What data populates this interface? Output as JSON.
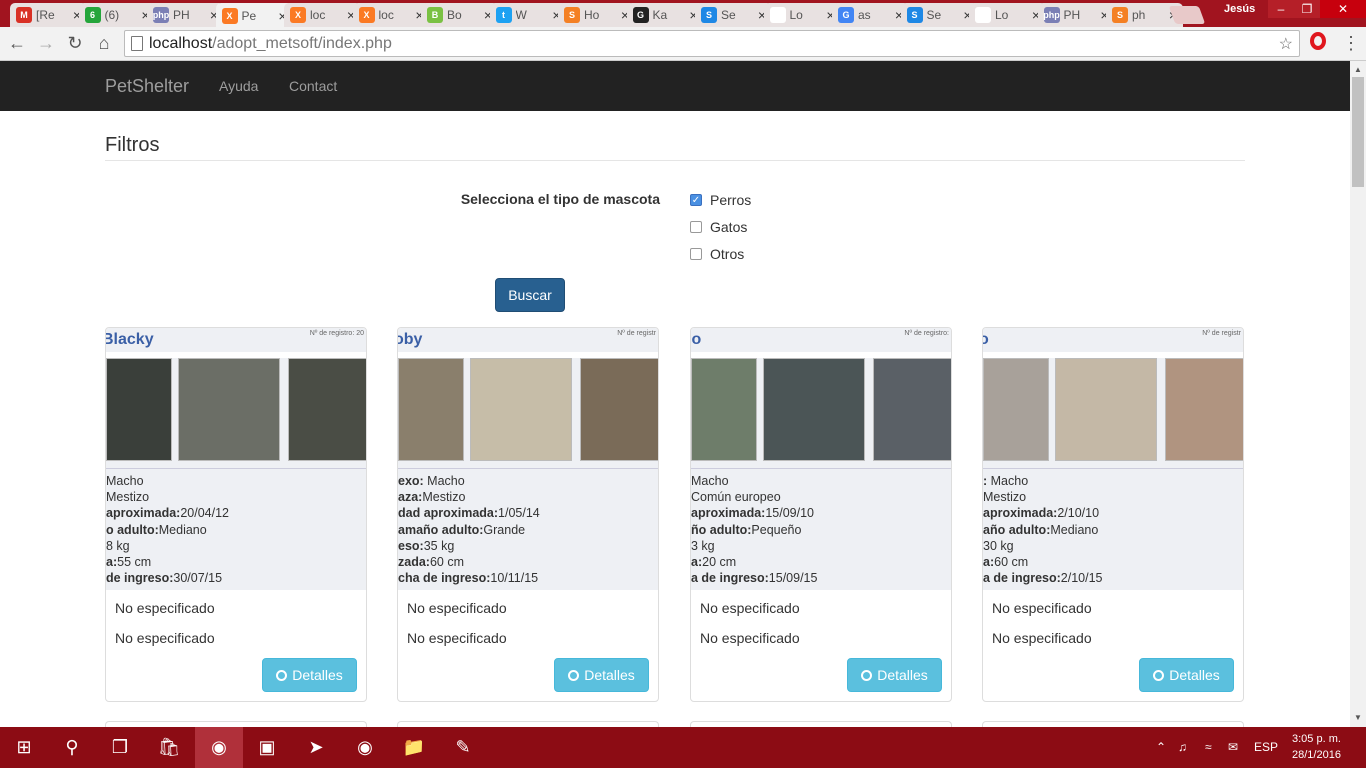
{
  "browser": {
    "tabs": [
      {
        "title": "[Re",
        "favicon_text": "M",
        "favicon_color": "#d93025",
        "active": false
      },
      {
        "title": "(6)",
        "favicon_text": "6",
        "favicon_color": "#25a53b",
        "active": false
      },
      {
        "title": "PH",
        "favicon_text": "php",
        "favicon_color": "#7b7fb5",
        "active": false
      },
      {
        "title": "Pe",
        "favicon_text": "X",
        "favicon_color": "#fb7a24",
        "active": true
      },
      {
        "title": "loc",
        "favicon_text": "X",
        "favicon_color": "#fb7a24",
        "active": false
      },
      {
        "title": "loc",
        "favicon_text": "X",
        "favicon_color": "#fb7a24",
        "active": false
      },
      {
        "title": "Bo",
        "favicon_text": "B",
        "favicon_color": "#7ac143",
        "active": false
      },
      {
        "title": "W",
        "favicon_text": "t",
        "favicon_color": "#1da1f2",
        "active": false
      },
      {
        "title": "Ho",
        "favicon_text": "S",
        "favicon_color": "#f48024",
        "active": false
      },
      {
        "title": "Ka",
        "favicon_text": "G",
        "favicon_color": "#222222",
        "active": false
      },
      {
        "title": "Se",
        "favicon_text": "S",
        "favicon_color": "#1e88e5",
        "active": false
      },
      {
        "title": "Lo",
        "favicon_text": "",
        "favicon_color": "#ffffff",
        "active": false
      },
      {
        "title": "as",
        "favicon_text": "G",
        "favicon_color": "#4285f4",
        "active": false
      },
      {
        "title": "Se",
        "favicon_text": "S",
        "favicon_color": "#1e88e5",
        "active": false
      },
      {
        "title": "Lo",
        "favicon_text": "",
        "favicon_color": "#ffffff",
        "active": false
      },
      {
        "title": "PH",
        "favicon_text": "php",
        "favicon_color": "#7b7fb5",
        "active": false
      },
      {
        "title": "ph",
        "favicon_text": "S",
        "favicon_color": "#f48024",
        "active": false
      }
    ],
    "user": "Jesús",
    "url_host": "localhost",
    "url_path": "/adopt_metsoft/index.php"
  },
  "site": {
    "brand": "PetShelter",
    "nav": [
      "Ayuda",
      "Contact"
    ]
  },
  "filters": {
    "title": "Filtros",
    "label": "Selecciona el tipo de mascota",
    "options": [
      {
        "label": "Perros",
        "checked": true
      },
      {
        "label": "Gatos",
        "checked": false
      },
      {
        "label": "Otros",
        "checked": false
      }
    ],
    "button": "Buscar"
  },
  "cards": [
    {
      "name": "Blacky",
      "reg": "Nº de registro: 20",
      "photo_colors": [
        "#3a3f3a",
        "#6b6e66",
        "#4a4d45"
      ],
      "facts": [
        {
          "k": "",
          "v": "Macho"
        },
        {
          "k": "",
          "v": "Mestizo"
        },
        {
          "k": "aproximada:",
          "v": "20/04/12"
        },
        {
          "k": "o adulto:",
          "v": "Mediano"
        },
        {
          "k": "",
          "v": "8 kg"
        },
        {
          "k": "a:",
          "v": "55 cm"
        },
        {
          "k": "de ingreso:",
          "v": "30/07/15"
        }
      ],
      "line1": "No especificado",
      "line2": "No especificado",
      "button": "Detalles"
    },
    {
      "name": "oby",
      "reg": "Nº de registr",
      "photo_colors": [
        "#8a7f6c",
        "#c6bda8",
        "#7a6b58"
      ],
      "facts": [
        {
          "k": "exo:",
          "v": " Macho"
        },
        {
          "k": "aza:",
          "v": "Mestizo"
        },
        {
          "k": "dad aproximada:",
          "v": "1/05/14"
        },
        {
          "k": "amaño adulto:",
          "v": "Grande"
        },
        {
          "k": "eso:",
          "v": "35 kg"
        },
        {
          "k": "zada:",
          "v": "60 cm"
        },
        {
          "k": "cha de ingreso:",
          "v": "10/11/15"
        }
      ],
      "line1": "No especificado",
      "line2": "No especificado",
      "button": "Detalles"
    },
    {
      "name": "jo",
      "reg": "Nº de registro:",
      "photo_colors": [
        "#6e7d6a",
        "#4b5556",
        "#5a6066"
      ],
      "facts": [
        {
          "k": "",
          "v": "Macho"
        },
        {
          "k": "",
          "v": "Común europeo"
        },
        {
          "k": "aproximada:",
          "v": "15/09/10"
        },
        {
          "k": "ño adulto:",
          "v": "Pequeño"
        },
        {
          "k": "",
          "v": "3 kg"
        },
        {
          "k": "a:",
          "v": "20 cm"
        },
        {
          "k": "a de ingreso:",
          "v": "15/09/15"
        }
      ],
      "line1": "No especificado",
      "line2": "No especificado",
      "button": "Detalles"
    },
    {
      "name": "o",
      "reg": "Nº de registr",
      "photo_colors": [
        "#a8a19a",
        "#c4b8a6",
        "#b09480"
      ],
      "facts": [
        {
          "k": ":",
          "v": " Macho"
        },
        {
          "k": "",
          "v": "Mestizo"
        },
        {
          "k": "aproximada:",
          "v": "2/10/10"
        },
        {
          "k": "año adulto:",
          "v": "Mediano"
        },
        {
          "k": "",
          "v": "30 kg"
        },
        {
          "k": "a:",
          "v": "60 cm"
        },
        {
          "k": "a de ingreso:",
          "v": "2/10/15"
        }
      ],
      "line1": "No especificado",
      "line2": "No especificado",
      "button": "Detalles"
    }
  ],
  "taskbar": {
    "language": "ESP",
    "time": "3:05 p. m.",
    "date": "28/1/2016"
  }
}
